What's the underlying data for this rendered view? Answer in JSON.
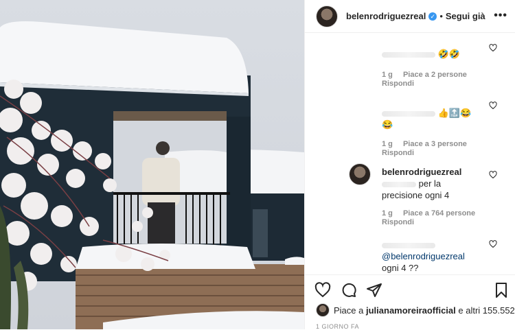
{
  "post": {
    "username": "belenrodriguezreal",
    "verified_icon": "verified-badge-icon",
    "separator": "•",
    "follow_label": "Segui già",
    "more_icon": "more-options-icon"
  },
  "comments": [
    {
      "emojis": "🤣🤣",
      "time": "1 g",
      "likes": "Piace a 2 persone",
      "reply": "Rispondi"
    },
    {
      "emojis": "👍🔝😂",
      "emojis2": "😂",
      "time": "1 g",
      "likes": "Piace a 3 persone",
      "reply": "Rispondi"
    },
    {
      "username": "belenrodriguezreal",
      "text1": "per la",
      "text2": "precisione ogni 4",
      "time": "1 g",
      "likes": "Piace a 764 persone",
      "reply": "Rispondi"
    },
    {
      "mention": "@belenrodriguezreal",
      "text": "ogni 4 ??"
    }
  ],
  "actions": {
    "like_icon": "heart-icon",
    "comment_icon": "comment-icon",
    "share_icon": "send-icon",
    "save_icon": "bookmark-icon"
  },
  "likes_line": {
    "prefix": "Piace a",
    "user": "julianamoreiraofficial",
    "suffix": "e altri 155.552"
  },
  "posted_ago": "1 GIORNO FA"
}
